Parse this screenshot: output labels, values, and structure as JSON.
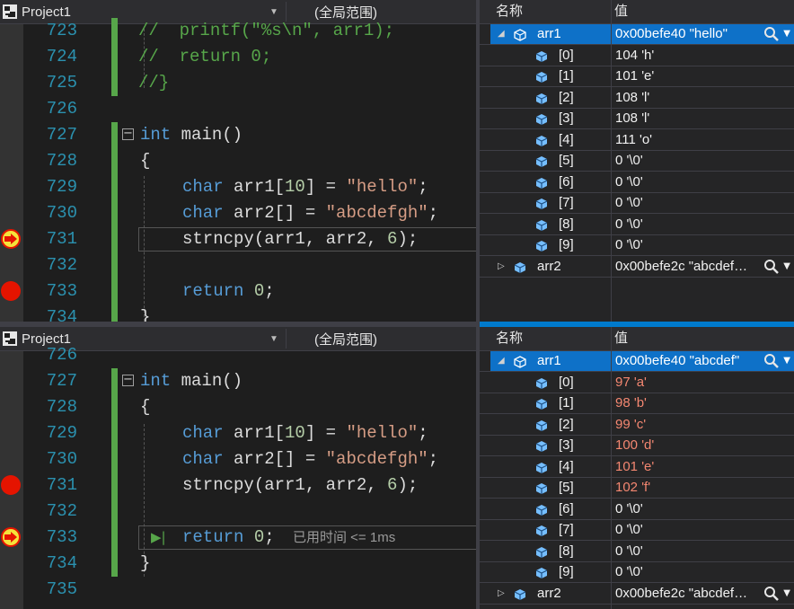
{
  "project_name": "Project1",
  "scope": "(全局范围)",
  "watch_headers": {
    "name": "名称",
    "value": "值"
  },
  "elapsed_text": "已用时间 <= 1ms",
  "code": {
    "l723": "//  printf(\"%s\\n\", arr1);",
    "l724": "//  return 0;",
    "l725": "//}",
    "l727_kw": "int",
    "l727_rest": " main()",
    "open_brace": "{",
    "close_brace": "}",
    "char_kw": "char",
    "arr1_decl": " arr1[",
    "arr1_size": "10",
    "arr1_eq": "] = ",
    "hello_str": "\"hello\"",
    "semi": ";",
    "arr2_decl": " arr2[] = ",
    "abc_str": "\"abcdefgh\"",
    "strncpy_call": "strncpy(arr1, arr2, ",
    "strncpy_n": "6",
    "strncpy_end": ");",
    "return_kw": "return",
    "return_sp": " ",
    "return_val": "0",
    "return_end": ";"
  },
  "panels": [
    {
      "line_numbers": [
        "723",
        "724",
        "725",
        "726",
        "727",
        "728",
        "729",
        "730",
        "731",
        "732",
        "733",
        "734"
      ],
      "watch": {
        "arr1": {
          "name": "arr1",
          "value": "0x00befe40 \"hello\""
        },
        "elements": [
          {
            "name": "[0]",
            "value": "104 'h'",
            "changed": false
          },
          {
            "name": "[1]",
            "value": "101 'e'",
            "changed": false
          },
          {
            "name": "[2]",
            "value": "108 'l'",
            "changed": false
          },
          {
            "name": "[3]",
            "value": "108 'l'",
            "changed": false
          },
          {
            "name": "[4]",
            "value": "111 'o'",
            "changed": false
          },
          {
            "name": "[5]",
            "value": "0 '\\0'",
            "changed": false
          },
          {
            "name": "[6]",
            "value": "0 '\\0'",
            "changed": false
          },
          {
            "name": "[7]",
            "value": "0 '\\0'",
            "changed": false
          },
          {
            "name": "[8]",
            "value": "0 '\\0'",
            "changed": false
          },
          {
            "name": "[9]",
            "value": "0 '\\0'",
            "changed": false
          }
        ],
        "arr2": {
          "name": "arr2",
          "value": "0x00befe2c \"abcdef…"
        }
      }
    },
    {
      "line_numbers": [
        "726",
        "727",
        "728",
        "729",
        "730",
        "731",
        "732",
        "733",
        "734",
        "735"
      ],
      "watch": {
        "arr1": {
          "name": "arr1",
          "value": "0x00befe40 \"abcdef\""
        },
        "elements": [
          {
            "name": "[0]",
            "value": "97 'a'",
            "changed": true
          },
          {
            "name": "[1]",
            "value": "98 'b'",
            "changed": true
          },
          {
            "name": "[2]",
            "value": "99 'c'",
            "changed": true
          },
          {
            "name": "[3]",
            "value": "100 'd'",
            "changed": true
          },
          {
            "name": "[4]",
            "value": "101 'e'",
            "changed": true
          },
          {
            "name": "[5]",
            "value": "102 'f'",
            "changed": true
          },
          {
            "name": "[6]",
            "value": "0 '\\0'",
            "changed": false
          },
          {
            "name": "[7]",
            "value": "0 '\\0'",
            "changed": false
          },
          {
            "name": "[8]",
            "value": "0 '\\0'",
            "changed": false
          },
          {
            "name": "[9]",
            "value": "0 '\\0'",
            "changed": false
          }
        ],
        "arr2": {
          "name": "arr2",
          "value": "0x00befe2c \"abcdef…"
        }
      }
    }
  ],
  "colors": {
    "keyword": "#569cd6",
    "string": "#d69d85",
    "comment": "#57a64a",
    "line_number": "#2b91af",
    "changed_value": "#f48771",
    "selection": "#0e71c8",
    "breakpoint": "#e51400",
    "accent": "#007acc"
  }
}
